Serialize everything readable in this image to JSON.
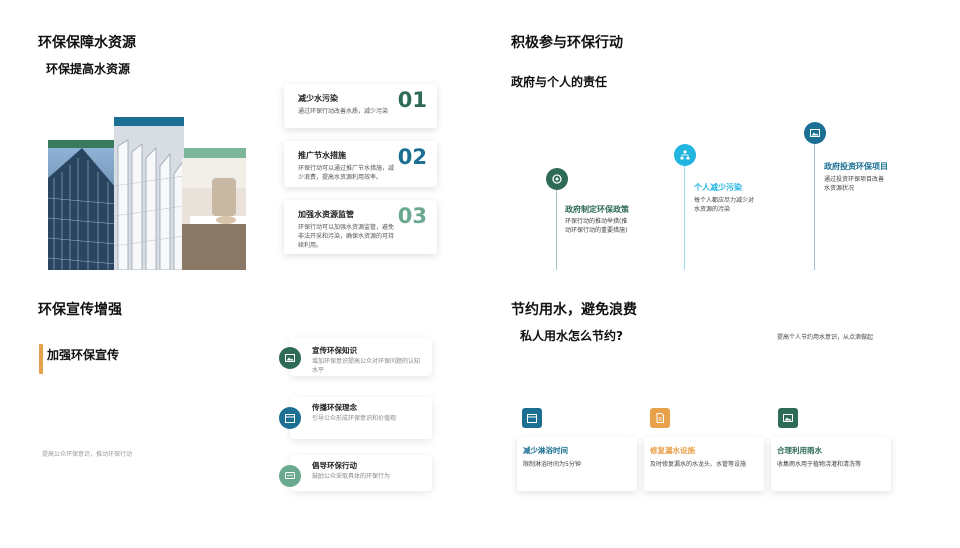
{
  "panel1": {
    "title": "环保保障水资源",
    "subtitle": "环保提高水资源",
    "cards": [
      {
        "title": "减少水污染",
        "desc": "通过环保行动改善水质，减少污染",
        "num": "01",
        "color": "#2e6b55"
      },
      {
        "title": "推广节水措施",
        "desc": "环保行动可以通过推广节水措施，减少浪费，提高水资源利用效率。",
        "num": "02",
        "color": "#1a6f93"
      },
      {
        "title": "加强水资源监管",
        "desc": "环保行动可以加强水资源监管，避免非法开采和污染，确保水资源的可持续利用。",
        "num": "03",
        "color": "#6aa890"
      }
    ],
    "colors": {
      "bar1": "#3a7a5e",
      "bar2": "#1a6f93",
      "bar3": "#7db59b"
    }
  },
  "panel2": {
    "title": "积极参与环保行动",
    "subtitle": "政府与个人的责任",
    "items": [
      {
        "title": "政府制定环保政策",
        "desc": "环保行动的推动举措(推动环保行动的重要措施)",
        "color": "#2e6b55",
        "icon": "target-icon"
      },
      {
        "title": "个人减少污染",
        "desc": "每个人都应尽力减少对水资源的污染",
        "color": "#22b5e0",
        "icon": "hierarchy-icon"
      },
      {
        "title": "政府投资环保项目",
        "desc": "通过投资环保项目改善水资源状况",
        "color": "#1a6f93",
        "icon": "image-icon"
      }
    ]
  },
  "panel3": {
    "title": "环保宣传增强",
    "subtitle": "加强环保宣传",
    "note": "提高公众环保意识，推动环保行动",
    "accent": "#e8a04a",
    "items": [
      {
        "title": "宣传环保知识",
        "desc": "增加环保意识提高公众对环保问题的认知水平",
        "color": "#2e6b55",
        "icon": "image-icon"
      },
      {
        "title": "传播环保理念",
        "desc": "引导公众形成环保意识和价值观",
        "color": "#1a6f93",
        "icon": "calendar-icon"
      },
      {
        "title": "倡导环保行动",
        "desc": "鼓励公众采取具体的环保行为",
        "color": "#6aa890",
        "icon": "chat-icon"
      }
    ]
  },
  "panel4": {
    "title": "节约用水，避免浪费",
    "subtitle": "私人用水怎么节约?",
    "note": "提高个人节约用水意识，从点滴做起",
    "items": [
      {
        "title": "减少淋浴时间",
        "desc": "限制淋浴时间为5分钟",
        "color": "#1a6f93",
        "icon": "calendar-icon"
      },
      {
        "title": "修复漏水设施",
        "desc": "及时修复漏水的水龙头、水管等设施",
        "color": "#e8a04a",
        "icon": "document-icon"
      },
      {
        "title": "合理利用雨水",
        "desc": "收集雨水用于植物浇灌和清洗等",
        "color": "#2e6b55",
        "icon": "image-icon"
      }
    ]
  }
}
